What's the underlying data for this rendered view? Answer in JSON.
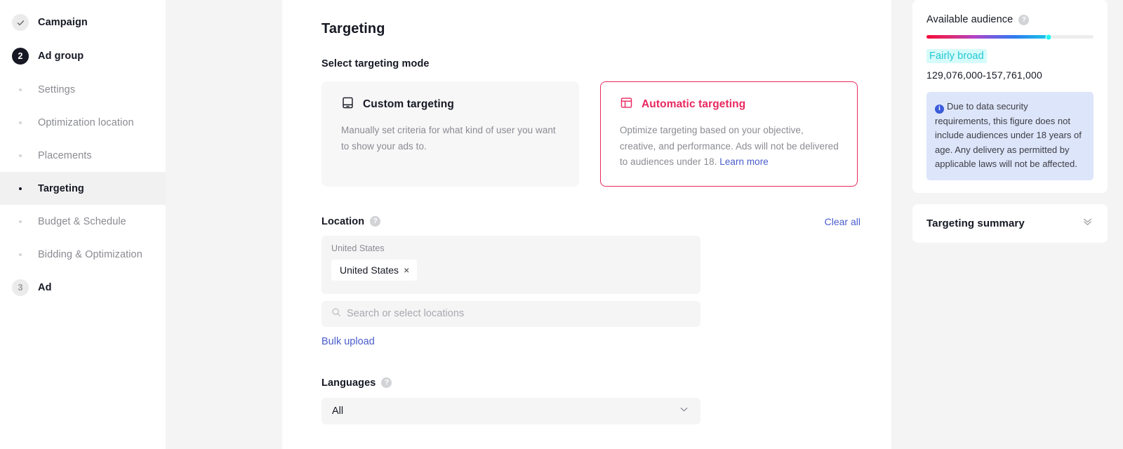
{
  "sidebar": {
    "steps": [
      {
        "badge": "check",
        "label": "Campaign",
        "state": "done"
      },
      {
        "badge": "2",
        "label": "Ad group",
        "state": "active"
      },
      {
        "badge": "3",
        "label": "Ad",
        "state": "todo"
      }
    ],
    "subitems": [
      {
        "label": "Settings",
        "selected": false
      },
      {
        "label": "Optimization location",
        "selected": false
      },
      {
        "label": "Placements",
        "selected": false
      },
      {
        "label": "Targeting",
        "selected": true
      },
      {
        "label": "Budget & Schedule",
        "selected": false
      },
      {
        "label": "Bidding & Optimization",
        "selected": false
      }
    ]
  },
  "main": {
    "page_title": "Targeting",
    "targeting_mode": {
      "label": "Select targeting mode",
      "custom": {
        "title": "Custom targeting",
        "description": "Manually set criteria for what kind of user you want to show your ads to.",
        "icon": "custom-targeting-icon",
        "selected": false
      },
      "automatic": {
        "title": "Automatic targeting",
        "description": "Optimize targeting based on your objective, creative, and performance. Ads will not be delivered to audiences under 18.",
        "link_label": "Learn more",
        "icon": "automatic-targeting-icon",
        "selected": true
      }
    },
    "location": {
      "label": "Location",
      "help": "?",
      "clear_all": "Clear all",
      "group_label": "United States",
      "tags": [
        {
          "label": "United States",
          "remove": "×"
        }
      ],
      "search_placeholder": "Search or select locations",
      "bulk_upload": "Bulk upload"
    },
    "languages": {
      "label": "Languages",
      "help": "?",
      "value": "All"
    }
  },
  "right": {
    "audience": {
      "title": "Available audience",
      "help": "?",
      "level_label": "Fairly broad",
      "range": "129,076,000-157,761,000",
      "gauge_percent": 73,
      "notice": "Due to data security requirements, this figure does not include audiences under 18 years of age. Any delivery as permitted by applicable laws will not be affected."
    },
    "summary": {
      "title": "Targeting summary",
      "chevron": "»"
    }
  },
  "colors": {
    "accent_pink": "#e8285f",
    "link_blue": "#4a5ccc",
    "cyan": "#22c8d4",
    "notice_bg": "#dde5fb"
  }
}
